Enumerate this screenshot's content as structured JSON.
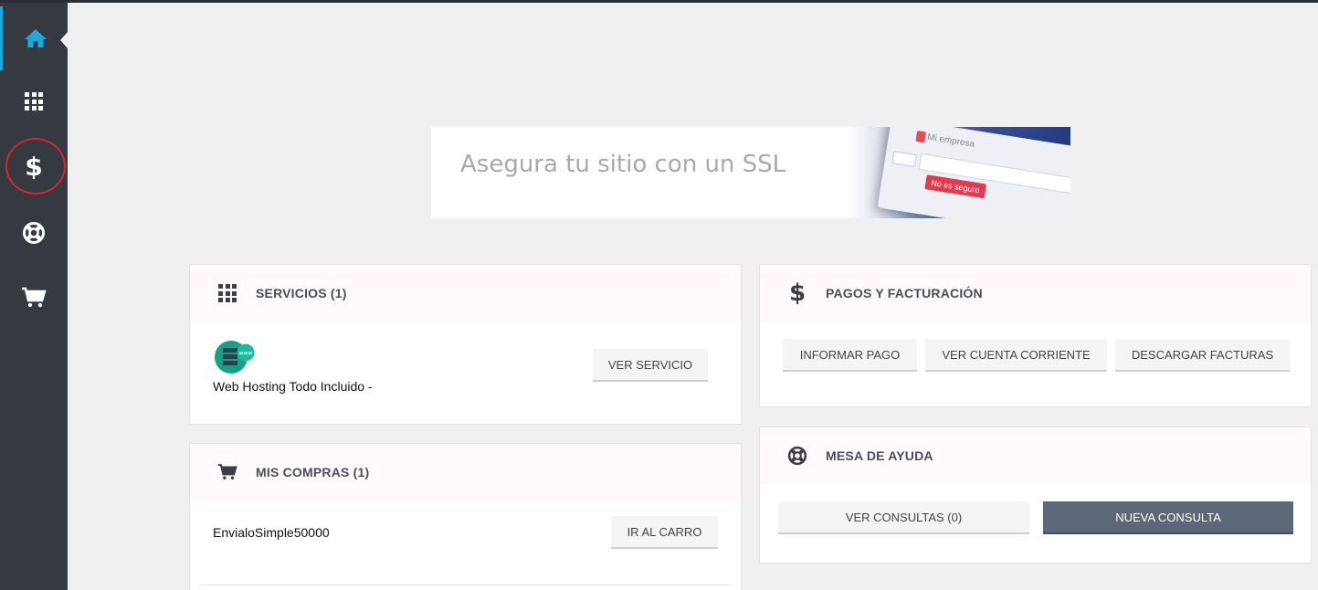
{
  "sidebar": {
    "items": [
      {
        "name": "home",
        "icon": "home-icon"
      },
      {
        "name": "services",
        "icon": "grid-icon"
      },
      {
        "name": "billing",
        "icon": "dollar-icon"
      },
      {
        "name": "support",
        "icon": "lifebuoy-icon"
      },
      {
        "name": "cart",
        "icon": "cart-icon"
      }
    ],
    "active_color": "#1ca8dd"
  },
  "banner": {
    "title": "Asegura tu sitio con un SSL",
    "browser_tab": "Mi empresa",
    "not_safe_label": "No es seguro"
  },
  "servicios": {
    "title": "SERVICIOS (1)",
    "item_name": "Web Hosting Todo Incluido -",
    "button": "VER SERVICIO",
    "logo_badge": "www"
  },
  "compras": {
    "title": "MIS COMPRAS (1)",
    "item_name": "EnvialoSimple50000",
    "button": "IR AL CARRO"
  },
  "pagos": {
    "title": "PAGOS Y FACTURACIÓN",
    "buttons": [
      "INFORMAR PAGO",
      "VER CUENTA CORRIENTE",
      "DESCARGAR FACTURAS"
    ]
  },
  "ayuda": {
    "title": "MESA DE AYUDA",
    "buttons": [
      "VER CONSULTAS (0)",
      "NUEVA CONSULTA"
    ]
  }
}
